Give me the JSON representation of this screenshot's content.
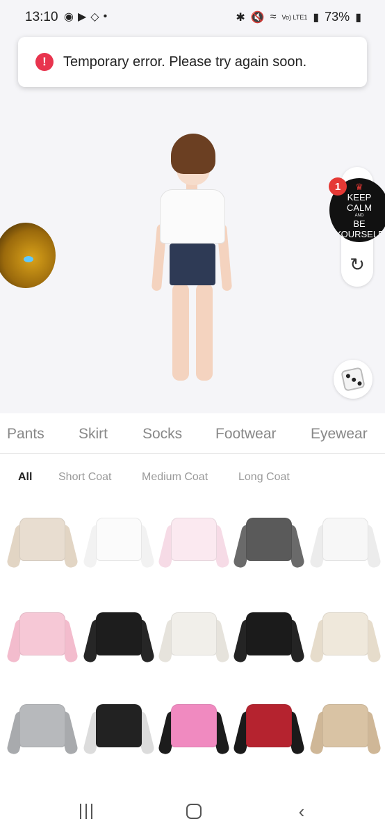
{
  "status_bar": {
    "time": "13:10",
    "battery": "73%",
    "network": "Vo) LTE1",
    "left_icons": [
      "discord-icon",
      "youtube-icon",
      "diamond-icon",
      "dot-icon"
    ],
    "right_icons": [
      "bluetooth-icon",
      "mute-icon",
      "wifi-icon",
      "signal-icon",
      "battery-icon"
    ]
  },
  "toast": {
    "icon": "!",
    "message": "Temporary error. Please try again soon."
  },
  "profile": {
    "badge_count": "1",
    "image_text_line1": "KEEP",
    "image_text_line2": "CALM",
    "image_text_line3": "AND",
    "image_text_line4": "BE",
    "image_text_line5": "YOURSELF"
  },
  "categories": [
    "Pants",
    "Skirt",
    "Socks",
    "Footwear",
    "Eyewear"
  ],
  "subtabs": [
    "All",
    "Short Coat",
    "Medium Coat",
    "Long Coat"
  ],
  "active_subtab": "All",
  "items": [
    {
      "name": "cream-cardigan-item",
      "color": "#e8ddd0",
      "sleeve": "#e2d5c4"
    },
    {
      "name": "white-bolero-item",
      "color": "#fbfbfb",
      "sleeve": "#f2f2f2"
    },
    {
      "name": "pink-bolero-item",
      "color": "#fbe9f0",
      "sleeve": "#f6dbe6"
    },
    {
      "name": "grey-crop-top-item",
      "color": "#5a5a5a",
      "sleeve": "#6a6a6a"
    },
    {
      "name": "white-shrug-item",
      "color": "#f7f7f7",
      "sleeve": "#ececec"
    },
    {
      "name": "pink-shrug-item",
      "color": "#f6c8d6",
      "sleeve": "#f3bccd"
    },
    {
      "name": "black-shrug-item",
      "color": "#1d1d1d",
      "sleeve": "#262626"
    },
    {
      "name": "white-fur-jacket-item",
      "color": "#f1efea",
      "sleeve": "#e6e3dc"
    },
    {
      "name": "black-jacket-item",
      "color": "#1b1b1b",
      "sleeve": "#242424"
    },
    {
      "name": "cream-knit-cardigan-item",
      "color": "#efe8db",
      "sleeve": "#e6dccb"
    },
    {
      "name": "grey-knit-cardigan-item",
      "color": "#b7b9bc",
      "sleeve": "#a8aaad"
    },
    {
      "name": "black-white-racing-jacket-item",
      "color": "#222222",
      "sleeve": "#dcdcdc"
    },
    {
      "name": "pink-flame-jacket-item",
      "color": "#f08ac0",
      "sleeve": "#1c1c1c"
    },
    {
      "name": "red-racing-jacket-item",
      "color": "#b5232f",
      "sleeve": "#1a1a1a"
    },
    {
      "name": "beige-trench-jacket-item",
      "color": "#d9c3a4",
      "sleeve": "#cfb797"
    }
  ]
}
